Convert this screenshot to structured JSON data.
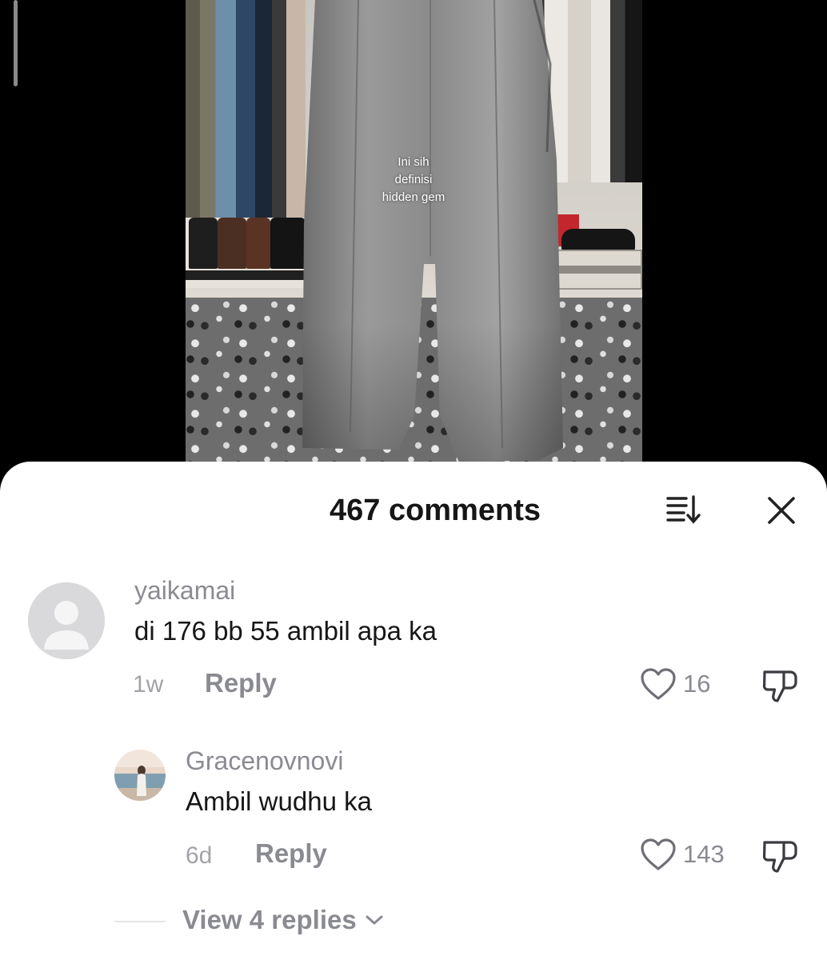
{
  "video": {
    "caption": "Ini sih\ndefinisi\nhidden gem"
  },
  "comments_sheet": {
    "title": "467 comments",
    "sort_icon": "sort-icon",
    "close_icon": "close-icon",
    "comments": [
      {
        "username": "yaikamai",
        "text": "di 176 bb 55 ambil apa ka",
        "time": "1w",
        "reply_label": "Reply",
        "likes": "16",
        "avatar": "default-avatar"
      },
      {
        "username": "Gracenovnovi",
        "text": "Ambil wudhu ka",
        "time": "6d",
        "reply_label": "Reply",
        "likes": "143",
        "avatar": "beach-photo-avatar"
      }
    ],
    "view_replies_label": "View 4 replies"
  },
  "colors": {
    "text_primary": "#161616",
    "text_secondary": "#8a8b91",
    "sheet_background": "#ffffff",
    "video_background": "#000000"
  }
}
